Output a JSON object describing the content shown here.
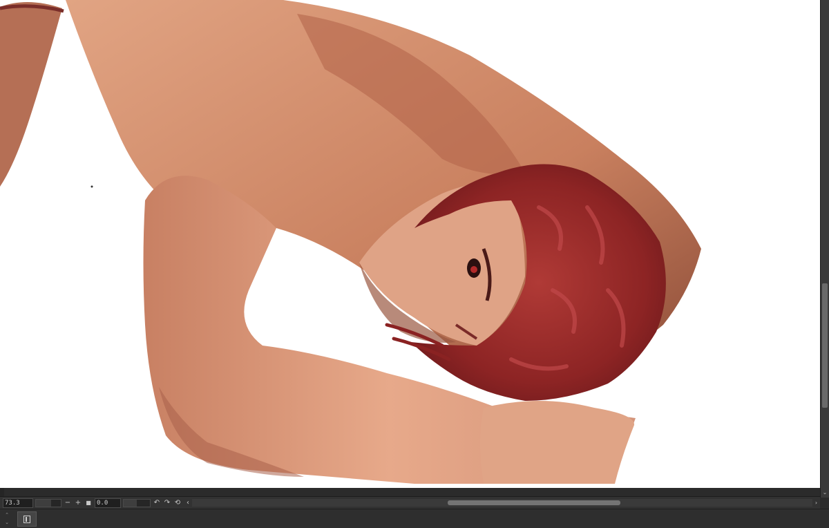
{
  "navigator": {
    "zoom_value": "73.3",
    "zoom_minus": "−",
    "zoom_plus": "+",
    "rotation_value": "0.0",
    "rotate_left_glyph": "↶",
    "rotate_right_glyph": "↷",
    "reset_glyph": "⟲",
    "prev_glyph": "‹"
  },
  "scrollbars": {
    "down_arrow": "⌄",
    "right_arrow": "›"
  },
  "panel": {
    "collapse_up": "⌃",
    "collapse_down": "⌄"
  },
  "icons": {
    "zoom_fit": "fit-to-window-icon",
    "panel_toggle": "panel-toggle-icon"
  },
  "colors": {
    "canvas": "#ffffff",
    "ui_dark": "#2b2b2b",
    "skin": "#d99676",
    "hair": "#9a2a2a"
  }
}
